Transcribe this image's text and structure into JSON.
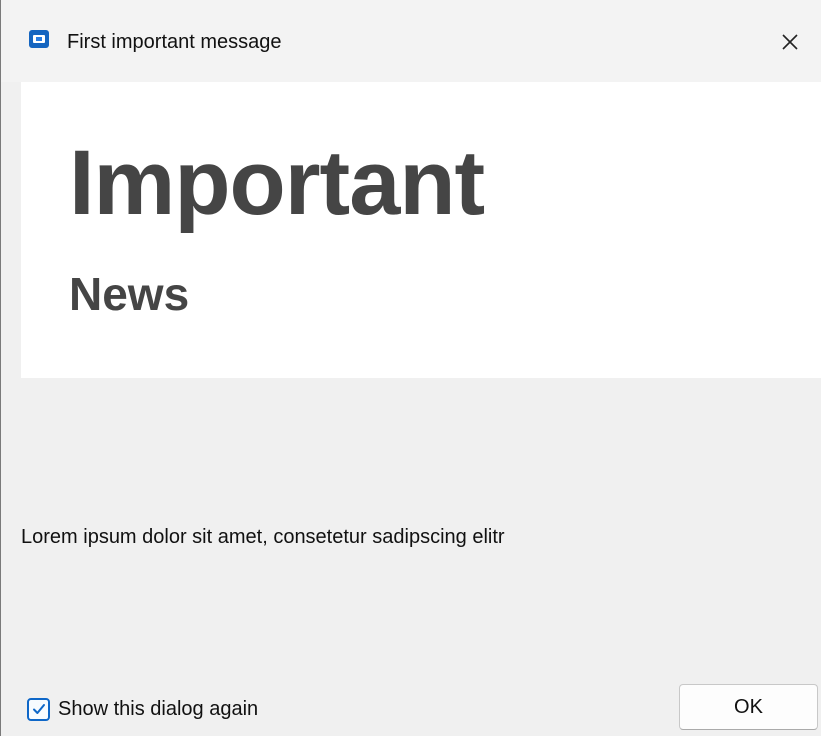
{
  "window": {
    "title": "First important message",
    "app_icon": "app-window-icon",
    "close_icon": "close-icon"
  },
  "banner": {
    "headline": "Important",
    "subheadline": "News",
    "background_color": "#ffffff",
    "text_color": "#454545"
  },
  "body": {
    "message": "Lorem ipsum dolor sit amet, consetetur sadipscing elitr"
  },
  "footer": {
    "checkbox_label": "Show this dialog again",
    "checkbox_checked": true,
    "checkbox_color": "#0e67c8",
    "ok_label": "OK"
  },
  "colors": {
    "dialog_background": "#f0f0f0",
    "accent": "#1565c0"
  }
}
